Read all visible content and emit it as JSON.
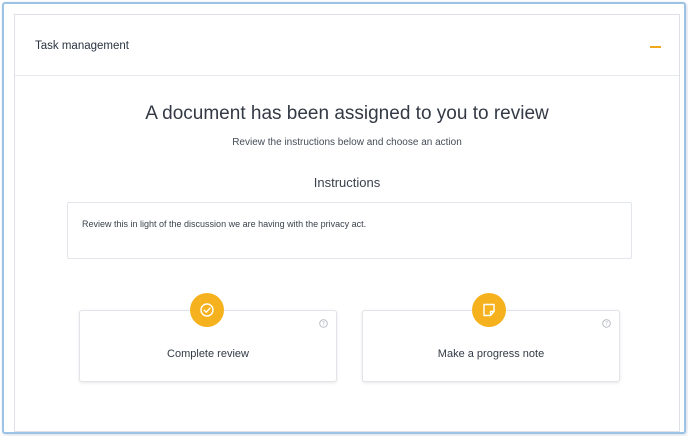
{
  "panel": {
    "title": "Task management"
  },
  "content": {
    "headline": "A document has been assigned to you to review",
    "subline": "Review the instructions below and choose an action",
    "instructions_title": "Instructions",
    "instructions_text": "Review this in light of the discussion we are having with the privacy act."
  },
  "actions": [
    {
      "label": "Complete review",
      "icon": "check-circle-icon"
    },
    {
      "label": "Make a progress note",
      "icon": "note-icon"
    }
  ],
  "colors": {
    "accent": "#f5b21e",
    "frame_border": "#9cc3e6"
  }
}
